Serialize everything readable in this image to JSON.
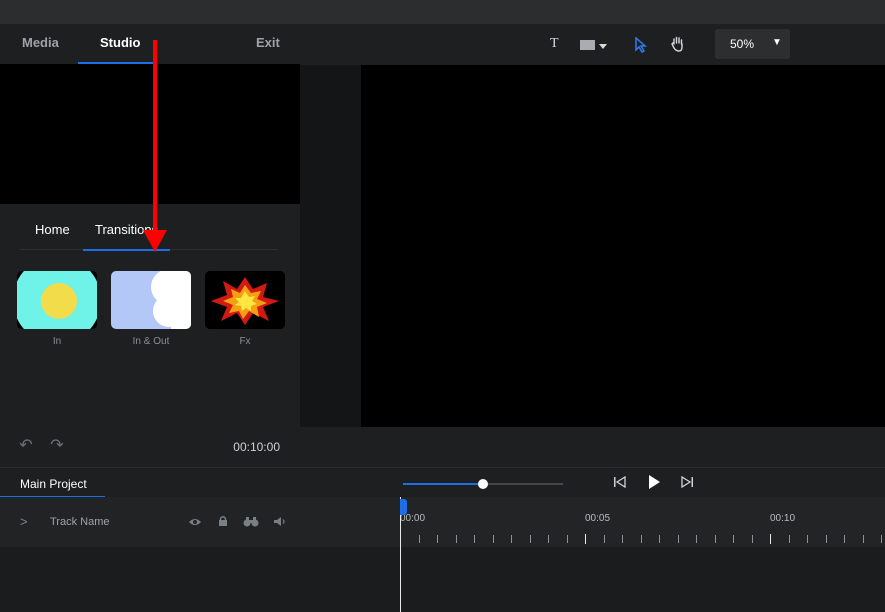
{
  "left_tabs": {
    "media": "Media",
    "studio": "Studio",
    "exit": "Exit"
  },
  "sub_tabs": {
    "home": "Home",
    "transitions": "Transitions"
  },
  "transitions": [
    {
      "label": "In"
    },
    {
      "label": "In & Out"
    },
    {
      "label": "Fx"
    }
  ],
  "duration": "00:10:00",
  "toolbar": {
    "text_tool": "T",
    "zoom": "50%"
  },
  "timeline": {
    "project_tab": "Main Project",
    "track_name": "Track Name",
    "ruler": [
      "00:00",
      "00:05",
      "00:10"
    ],
    "scrubber_progress": 0.5
  },
  "colors": {
    "accent": "#1e6ee8",
    "annotation": "#ff0000"
  }
}
